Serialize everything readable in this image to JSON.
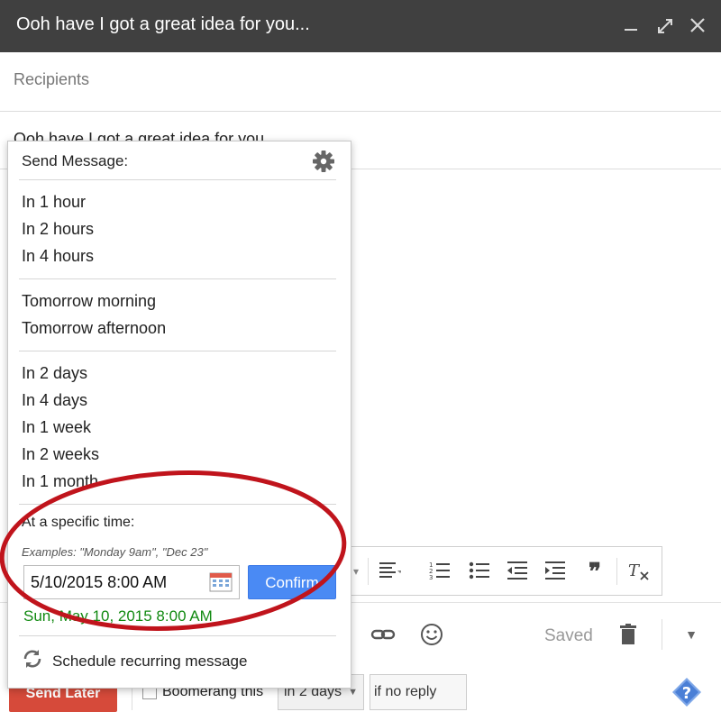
{
  "window": {
    "title": "Ooh have I got a great idea for you...",
    "minimize_icon": "minimize-icon",
    "expand_icon": "expand-icon",
    "close_icon": "close-icon"
  },
  "compose": {
    "recipients_placeholder": "Recipients",
    "subject": "Ooh have I got a great idea for you"
  },
  "send_menu": {
    "header": "Send Message:",
    "groups": [
      [
        "In 1 hour",
        "In 2 hours",
        "In 4 hours"
      ],
      [
        "Tomorrow morning",
        "Tomorrow afternoon"
      ],
      [
        "In 2 days",
        "In 4 days",
        "In 1 week",
        "In 2 weeks",
        "In 1 month"
      ]
    ],
    "specific_time_label": "At a specific time:",
    "examples": "Examples: \"Monday 9am\", \"Dec 23\"",
    "date_value": "5/10/2015 8:00 AM",
    "confirm_label": "Confirm",
    "parsed_date": "Sun, May 10, 2015 8:00 AM",
    "recurring_label": "Schedule recurring message",
    "highlight_color": "#c0141c"
  },
  "bottom_bar": {
    "saved_label": "Saved"
  },
  "footer": {
    "send_later_label": "Send Later",
    "boomerang_label": "Boomerang this",
    "days_value": "in 2 days",
    "no_reply_value": "if no reply"
  },
  "colors": {
    "titlebar": "#404040",
    "send_later": "#d64a3a",
    "confirm": "#4a8af4",
    "parsed_date": "#128a12"
  }
}
